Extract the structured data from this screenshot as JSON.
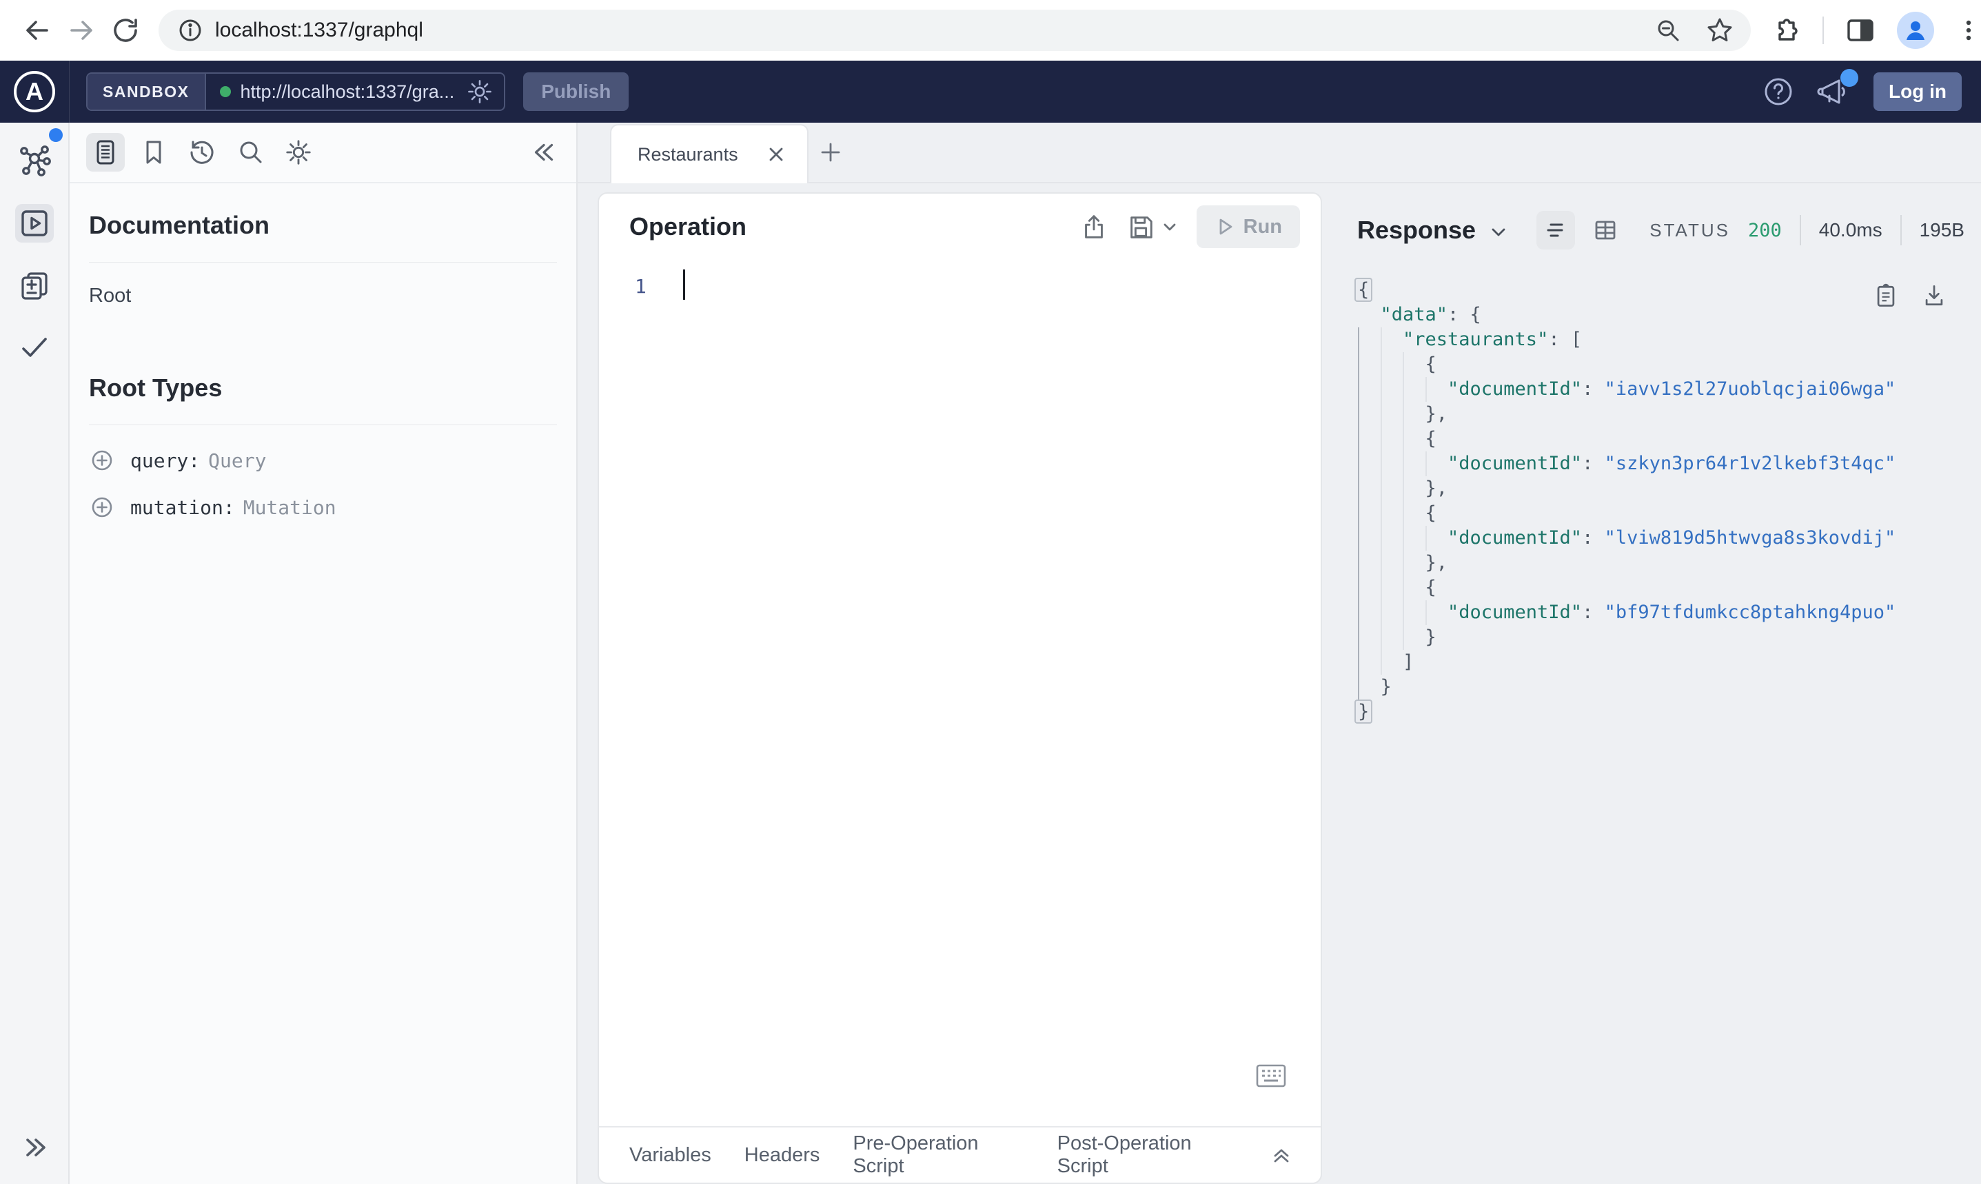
{
  "browser": {
    "url": "localhost:1337/graphql"
  },
  "apollo_header": {
    "logo_letter": "A",
    "env_label": "SANDBOX",
    "endpoint": "http://localhost:1337/gra...",
    "publish_label": "Publish",
    "login_label": "Log in"
  },
  "docs": {
    "title": "Documentation",
    "root_label": "Root",
    "root_types_title": "Root Types",
    "fields": [
      {
        "name": "query:",
        "type": "Query"
      },
      {
        "name": "mutation:",
        "type": "Mutation"
      }
    ]
  },
  "tabs": {
    "active_label": "Restaurants"
  },
  "operation": {
    "title": "Operation",
    "run_label": "Run",
    "line_number": "1"
  },
  "footer": {
    "tabs": [
      "Variables",
      "Headers",
      "Pre-Operation Script",
      "Post-Operation Script"
    ]
  },
  "response": {
    "title": "Response",
    "status_label": "STATUS",
    "status_code": "200",
    "duration": "40.0ms",
    "size": "195B",
    "json_lines": [
      [
        [
          "hb",
          "{"
        ]
      ],
      [
        [
          "i",
          "  "
        ],
        [
          "k",
          "\"data\""
        ],
        [
          "p",
          ": {"
        ]
      ],
      [
        [
          "i",
          "  "
        ],
        [
          "i",
          "  "
        ],
        [
          "k",
          "\"restaurants\""
        ],
        [
          "p",
          ": ["
        ]
      ],
      [
        [
          "i",
          "  "
        ],
        [
          "i",
          "  "
        ],
        [
          "i",
          "  "
        ],
        [
          "p",
          "{"
        ]
      ],
      [
        [
          "i",
          "  "
        ],
        [
          "i",
          "  "
        ],
        [
          "i",
          "  "
        ],
        [
          "i",
          "  "
        ],
        [
          "k",
          "\"documentId\""
        ],
        [
          "p",
          ": "
        ],
        [
          "v",
          "\"iavv1s2l27uoblqcjai06wga\""
        ]
      ],
      [
        [
          "i",
          "  "
        ],
        [
          "i",
          "  "
        ],
        [
          "i",
          "  "
        ],
        [
          "p",
          "},"
        ]
      ],
      [
        [
          "i",
          "  "
        ],
        [
          "i",
          "  "
        ],
        [
          "i",
          "  "
        ],
        [
          "p",
          "{"
        ]
      ],
      [
        [
          "i",
          "  "
        ],
        [
          "i",
          "  "
        ],
        [
          "i",
          "  "
        ],
        [
          "i",
          "  "
        ],
        [
          "k",
          "\"documentId\""
        ],
        [
          "p",
          ": "
        ],
        [
          "v",
          "\"szkyn3pr64r1v2lkebf3t4qc\""
        ]
      ],
      [
        [
          "i",
          "  "
        ],
        [
          "i",
          "  "
        ],
        [
          "i",
          "  "
        ],
        [
          "p",
          "},"
        ]
      ],
      [
        [
          "i",
          "  "
        ],
        [
          "i",
          "  "
        ],
        [
          "i",
          "  "
        ],
        [
          "p",
          "{"
        ]
      ],
      [
        [
          "i",
          "  "
        ],
        [
          "i",
          "  "
        ],
        [
          "i",
          "  "
        ],
        [
          "i",
          "  "
        ],
        [
          "k",
          "\"documentId\""
        ],
        [
          "p",
          ": "
        ],
        [
          "v",
          "\"lviw819d5htwvga8s3kovdij\""
        ]
      ],
      [
        [
          "i",
          "  "
        ],
        [
          "i",
          "  "
        ],
        [
          "i",
          "  "
        ],
        [
          "p",
          "},"
        ]
      ],
      [
        [
          "i",
          "  "
        ],
        [
          "i",
          "  "
        ],
        [
          "i",
          "  "
        ],
        [
          "p",
          "{"
        ]
      ],
      [
        [
          "i",
          "  "
        ],
        [
          "i",
          "  "
        ],
        [
          "i",
          "  "
        ],
        [
          "i",
          "  "
        ],
        [
          "k",
          "\"documentId\""
        ],
        [
          "p",
          ": "
        ],
        [
          "v",
          "\"bf97tfdumkcc8ptahkng4puo\""
        ]
      ],
      [
        [
          "i",
          "  "
        ],
        [
          "i",
          "  "
        ],
        [
          "i",
          "  "
        ],
        [
          "p",
          "}"
        ]
      ],
      [
        [
          "i",
          "  "
        ],
        [
          "i",
          "  "
        ],
        [
          "p",
          "]"
        ]
      ],
      [
        [
          "i",
          "  "
        ],
        [
          "p",
          "}"
        ]
      ],
      [
        [
          "hb",
          "}"
        ]
      ]
    ]
  },
  "colors": {
    "status_green": "#2a9b6f",
    "key_teal": "#1d7569",
    "value_blue": "#3470c2",
    "header_navy": "#1d2443",
    "accent_blue": "#2e7ef0"
  }
}
